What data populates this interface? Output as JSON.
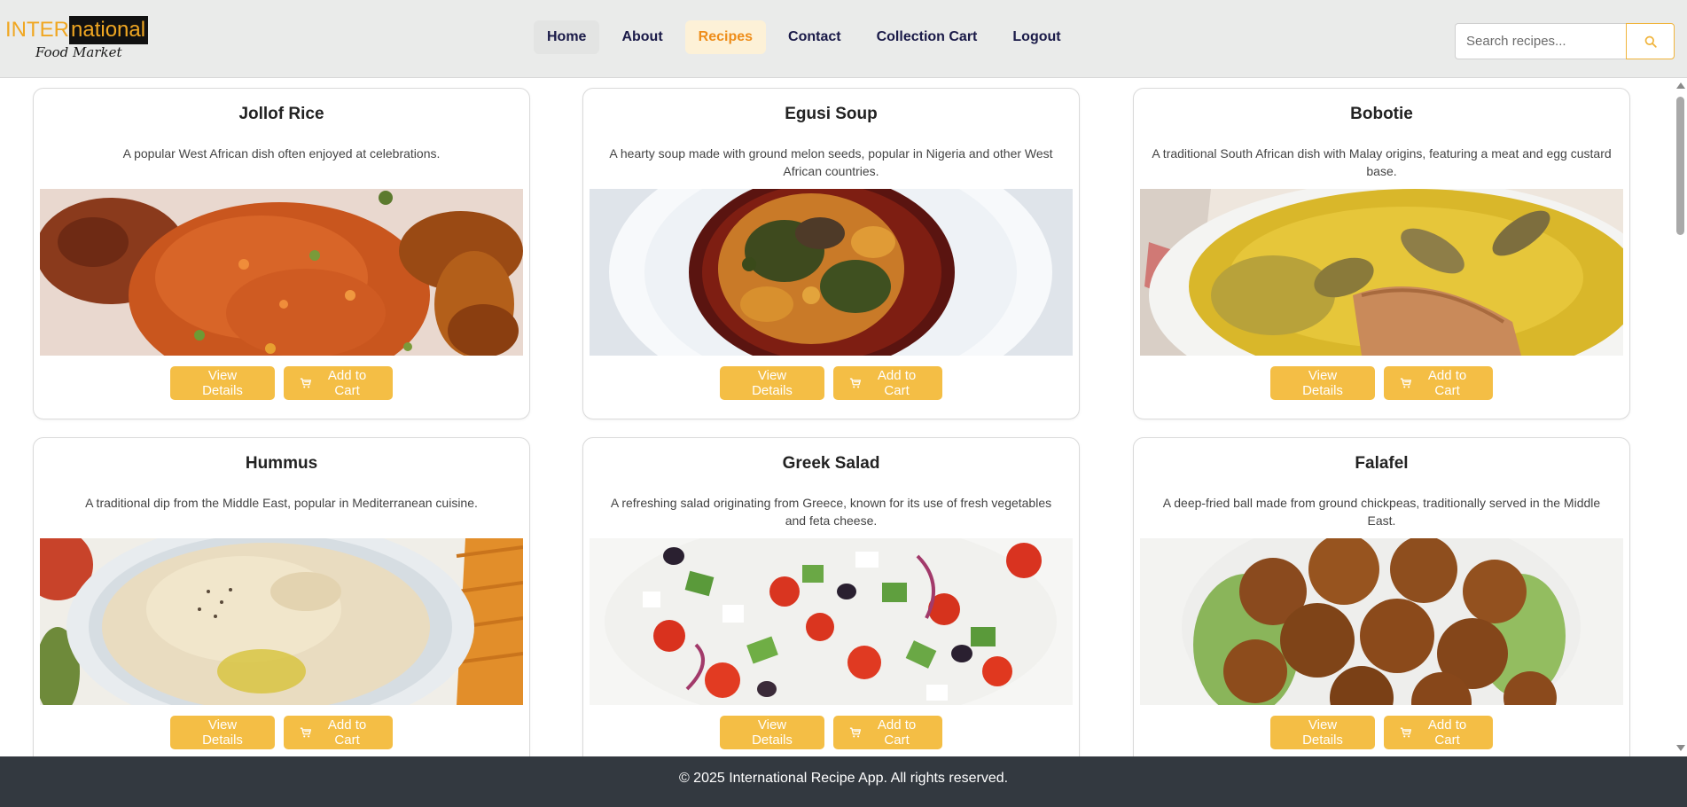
{
  "header": {
    "logo": {
      "part1": "INTER",
      "part2": "national",
      "tagline": "Food Market"
    },
    "nav": [
      {
        "label": "Home"
      },
      {
        "label": "About"
      },
      {
        "label": "Recipes",
        "active": true
      },
      {
        "label": "Contact"
      },
      {
        "label": "Collection Cart"
      },
      {
        "label": "Logout"
      }
    ],
    "search": {
      "placeholder": "Search recipes...",
      "value": "",
      "icon": "search-icon"
    }
  },
  "recipes": [
    {
      "title": "Jollof Rice",
      "description": "A popular West African dish often enjoyed at celebrations.",
      "view_label": "View Details",
      "cart_label": "Add to Cart"
    },
    {
      "title": "Egusi Soup",
      "description": "A hearty soup made with ground melon seeds, popular in Nigeria and other West African countries.",
      "view_label": "View Details",
      "cart_label": "Add to Cart"
    },
    {
      "title": "Bobotie",
      "description": "A traditional South African dish with Malay origins, featuring a meat and egg custard base.",
      "view_label": "View Details",
      "cart_label": "Add to Cart"
    },
    {
      "title": "Hummus",
      "description": "A traditional dip from the Middle East, popular in Mediterranean cuisine.",
      "view_label": "View Details",
      "cart_label": "Add to Cart"
    },
    {
      "title": "Greek Salad",
      "description": "A refreshing salad originating from Greece, known for its use of fresh vegetables and feta cheese.",
      "view_label": "View Details",
      "cart_label": "Add to Cart"
    },
    {
      "title": "Falafel",
      "description": "A deep-fried ball made from ground chickpeas, traditionally served in the Middle East.",
      "view_label": "View Details",
      "cart_label": "Add to Cart"
    }
  ],
  "footer": {
    "text": "© 2025 International Recipe App. All rights reserved."
  },
  "colors": {
    "accent": "#f4be45",
    "nav_active": "#ee8d1a",
    "footer_bg": "#333940",
    "header_bg": "#eaebea"
  }
}
